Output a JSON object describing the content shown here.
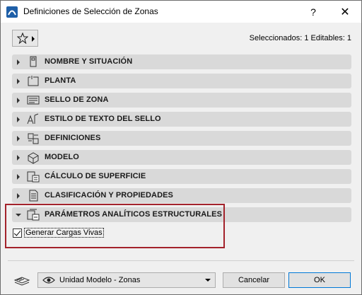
{
  "window": {
    "title": "Definiciones de Selección de Zonas",
    "help_label": "?",
    "close_label": "✕"
  },
  "selection_info": "Seleccionados: 1 Editables: 1",
  "panels": [
    {
      "label": "NOMBRE Y SITUACIÓN",
      "icon": "name-location-icon",
      "expanded": false
    },
    {
      "label": "PLANTA",
      "icon": "floor-plan-icon",
      "expanded": false
    },
    {
      "label": "SELLO DE ZONA",
      "icon": "zone-stamp-icon",
      "expanded": false
    },
    {
      "label": "ESTILO DE TEXTO DEL SELLO",
      "icon": "text-style-icon",
      "expanded": false
    },
    {
      "label": "DEFINICIONES",
      "icon": "definitions-icon",
      "expanded": false
    },
    {
      "label": "MODELO",
      "icon": "model-icon",
      "expanded": false
    },
    {
      "label": "CÁLCULO DE SUPERFICIE",
      "icon": "area-calculation-icon",
      "expanded": false
    },
    {
      "label": "CLASIFICACIÓN Y PROPIEDADES",
      "icon": "classification-icon",
      "expanded": false
    },
    {
      "label": "PARÁMETROS ANALÍTICOS ESTRUCTURALES",
      "icon": "structural-analytics-icon",
      "expanded": true
    }
  ],
  "structural": {
    "live_loads_label": "Generar Cargas Vivas",
    "live_loads_checked": true
  },
  "footer": {
    "view_select_value": "Unidad Modelo - Zonas",
    "cancel_label": "Cancelar",
    "ok_label": "OK"
  },
  "colors": {
    "highlight": "#a3222b",
    "panel_bg": "#d9d9d9",
    "ok_border": "#0078d7"
  }
}
